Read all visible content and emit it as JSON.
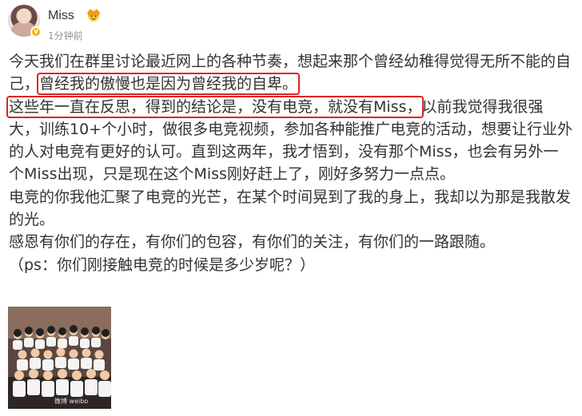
{
  "post": {
    "author": {
      "name": "Miss",
      "avatar_icon": "user-avatar",
      "badge_icon": "crown-emoji-icon",
      "verified_icon": "verified-badge-icon"
    },
    "timestamp": "1分钟前",
    "paragraphs": {
      "p1": {
        "pre": "今天我们在群里讨论最近网上的各种节奏，想起来那个曾经幼稚得觉得无所不能的自己，",
        "highlight": "曾经我的傲慢也是因为曾经我的自卑。"
      },
      "p2": {
        "highlight": "这些年一直在反思，得到的结论是，没有电竞，就没有Miss，",
        "post": "以前我觉得我很强大，训练10+个小时，做很多电竞视频，参加各种能推广电竞的活动，想要让行业外的人对电竞有更好的认可。直到这两年，我才悟到，没有那个Miss，也会有另外一个Miss出现，只是现在这个Miss刚好赶上了，刚好多努力一点点。"
      },
      "p3": "电竞的你我他汇聚了电竞的光芒，在某个时间晃到了我的身上，我却以为那是我散发的光。",
      "p4": "感恩有你们的存在，有你们的包容，有你们的关注，有你们的一路跟随。",
      "p5": "（ps：你们刚接触电竞的时候是多少岁呢？）"
    },
    "image": {
      "icon": "group-photo-thumbnail",
      "watermark": "微博 weibo"
    },
    "colors": {
      "highlight_box": "#e02020",
      "text": "#333333",
      "timestamp": "#939393",
      "verified": "#f7b500"
    }
  }
}
